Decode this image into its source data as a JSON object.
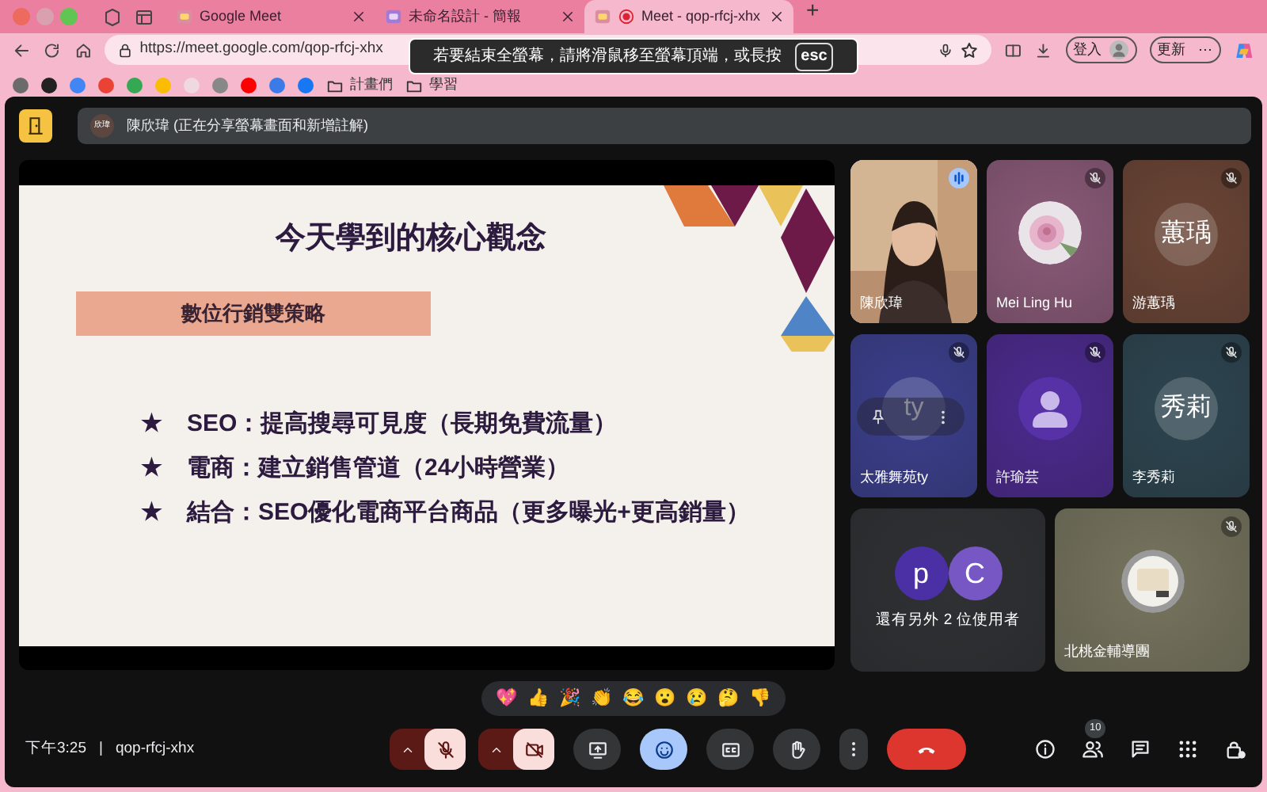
{
  "browser": {
    "tabs": [
      {
        "title": "Google Meet",
        "selected": false,
        "recording": false
      },
      {
        "title": "未命名設計 - 簡報",
        "selected": false,
        "recording": false
      },
      {
        "title": "Meet - qop-rfcj-xhx",
        "selected": true,
        "recording": true
      }
    ],
    "new_tab": "+",
    "url": "https://meet.google.com/qop-rfcj-xhx",
    "sign_in": "登入",
    "update": "更新",
    "update_more": "⋯",
    "bookmarks": [
      {
        "kind": "site",
        "color": "#6b6b6b"
      },
      {
        "kind": "site",
        "color": "#222222"
      },
      {
        "kind": "site",
        "color": "#4285f4"
      },
      {
        "kind": "site",
        "color": "#ea4335"
      },
      {
        "kind": "site",
        "color": "#34a853"
      },
      {
        "kind": "site",
        "color": "#fbbc04"
      },
      {
        "kind": "site",
        "color": "#f0d8e0"
      },
      {
        "kind": "site",
        "color": "#888888"
      },
      {
        "kind": "site",
        "color": "#ff0000"
      },
      {
        "kind": "site",
        "color": "#3b7be8"
      },
      {
        "kind": "site",
        "color": "#1877f2"
      },
      {
        "kind": "folder",
        "label": "計畫們"
      },
      {
        "kind": "folder",
        "label": "學習"
      }
    ],
    "fullscreen_toast": {
      "text": "若要結束全螢幕，請將滑鼠移至螢幕頂端，或長按",
      "key": "esc"
    }
  },
  "meet": {
    "presenter": {
      "avatar_text": "欣瑋",
      "text": "陳欣瑋 (正在分享螢幕畫面和新增註解)"
    },
    "slide": {
      "title": "今天學到的核心觀念",
      "section": "數位行銷雙策略",
      "bullets": [
        {
          "marker": "★",
          "text": "SEO：提高搜尋可見度（長期免費流量）"
        },
        {
          "marker": "★",
          "text": "電商：建立銷售管道（24小時營業）"
        },
        {
          "marker": "★",
          "text": "結合：SEO優化電商平台商品（更多曝光+更高銷量）"
        }
      ]
    },
    "tiles": [
      {
        "kind": "video",
        "name": "陳欣瑋",
        "color": "#c9a98a",
        "muted": false,
        "speaking": true,
        "hovered": false
      },
      {
        "kind": "picture",
        "name": "Mei Ling Hu",
        "color": "#8a5a78",
        "muted": true,
        "speaking": false,
        "hovered": false
      },
      {
        "kind": "initials",
        "name": "游蕙瑀",
        "avatar": "蕙瑀",
        "color": "#6b4536",
        "muted": true,
        "speaking": false,
        "hovered": false
      },
      {
        "kind": "initials",
        "name": "太雅舞苑ty",
        "avatar": "ty",
        "color": "#3b3f8c",
        "muted": true,
        "speaking": false,
        "hovered": true
      },
      {
        "kind": "person",
        "name": "許瑜芸",
        "color": "#4c2a8e",
        "muted": true,
        "speaking": false,
        "hovered": false
      },
      {
        "kind": "initials",
        "name": "李秀莉",
        "avatar": "秀莉",
        "color": "#2d4550",
        "muted": true,
        "speaking": false,
        "hovered": false
      },
      {
        "kind": "others",
        "text": "還有另外 2 位使用者",
        "color": "#303134",
        "avatars": [
          {
            "letter": "p",
            "color": "#4a2fa5"
          },
          {
            "letter": "C",
            "color": "#7757c4"
          }
        ]
      },
      {
        "kind": "picture",
        "name": "北桃金輔導團",
        "color": "#77755f",
        "muted": true,
        "speaking": false,
        "hovered": false
      }
    ],
    "reactions": [
      "💖",
      "👍",
      "🎉",
      "👏",
      "😂",
      "😮",
      "😢",
      "🤔",
      "👎"
    ],
    "time": "下午3:25",
    "separator": "|",
    "meeting_code": "qop-rfcj-xhx",
    "controls": [
      {
        "kind": "mic",
        "on": false
      },
      {
        "kind": "camera",
        "on": false
      },
      {
        "kind": "present",
        "on": false
      },
      {
        "kind": "emoji",
        "on": true
      },
      {
        "kind": "captions",
        "on": false
      },
      {
        "kind": "hand",
        "on": false
      },
      {
        "kind": "more",
        "on": false
      },
      {
        "kind": "leave"
      }
    ],
    "people_count": "10"
  }
}
